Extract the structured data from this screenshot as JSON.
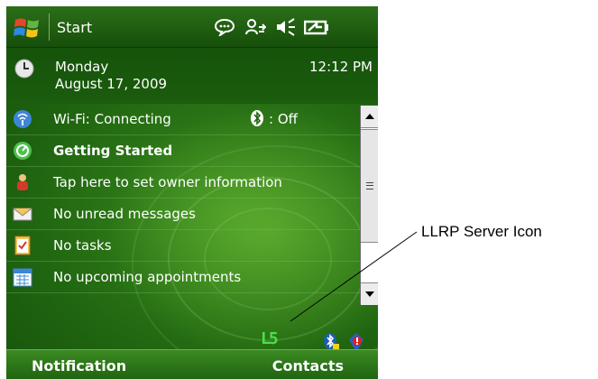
{
  "titlebar": {
    "start_label": "Start",
    "tray_icons": [
      "connectivity-icon",
      "activesync-icon",
      "volume-mute-icon",
      "battery-icon"
    ]
  },
  "today": {
    "day": "Monday",
    "date": "August 17, 2009",
    "time": "12:12 PM"
  },
  "items": [
    {
      "icon": "wifi-icon",
      "label": "Wi-Fi: Connecting",
      "bluetooth_label": ": Off"
    },
    {
      "icon": "getting-started-icon",
      "label": "Getting Started"
    },
    {
      "icon": "owner-icon",
      "label": "Tap here to set owner information"
    },
    {
      "icon": "mail-icon",
      "label": "No unread messages"
    },
    {
      "icon": "tasks-icon",
      "label": "No tasks"
    },
    {
      "icon": "calendar-icon",
      "label": "No upcoming appointments"
    }
  ],
  "status_tray": {
    "llrp_glyph": "L5",
    "icons": [
      "llrp-server-icon",
      "bluetooth-tray-icon",
      "battery-warning-icon"
    ]
  },
  "softkeys": {
    "left": "Notification",
    "right": "Contacts"
  },
  "callout": {
    "label": "LLRP Server Icon"
  },
  "colors": {
    "background_green": "#1f6410",
    "accent_green": "#49e04a"
  }
}
